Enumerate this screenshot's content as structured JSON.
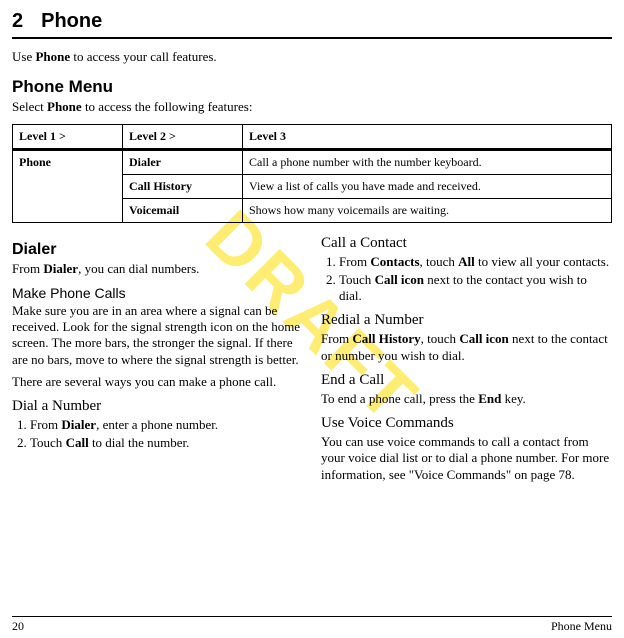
{
  "chapter": {
    "number": "2",
    "title": "Phone"
  },
  "intro": {
    "pre": "Use ",
    "bold": "Phone",
    "post": " to access your call features."
  },
  "menu": {
    "heading": "Phone Menu",
    "intro_pre": "Select ",
    "intro_bold": "Phone",
    "intro_post": " to access the following features:"
  },
  "table": {
    "headers": {
      "c1": "Level 1 >",
      "c2": "Level 2 >",
      "c3": "Level 3"
    },
    "rows": [
      {
        "c1": "Phone",
        "c2": "Dialer",
        "c3": "Call a phone number with the number keyboard."
      },
      {
        "c1": "",
        "c2": "Call History",
        "c3": "View a list of calls you have made and received."
      },
      {
        "c1": "",
        "c2": "Voicemail",
        "c3": "Shows how many voicemails are waiting."
      }
    ]
  },
  "left": {
    "dialer_h": "Dialer",
    "dialer_p_pre": "From ",
    "dialer_p_bold": "Dialer",
    "dialer_p_post": ", you can dial numbers.",
    "mpc_h": "Make Phone Calls",
    "mpc_p1": "Make sure you are in an area where a signal can be received. Look for the signal strength icon on the home screen. The more bars, the stronger the signal. If there are no bars, move to where the signal strength is better.",
    "mpc_p2": "There are several ways you can make a phone call.",
    "dan_h": "Dial a Number",
    "dan_1_pre": "From ",
    "dan_1_bold": "Dialer",
    "dan_1_post": ", enter a phone number.",
    "dan_2_pre": "Touch ",
    "dan_2_bold": "Call",
    "dan_2_post": " to dial the number."
  },
  "right": {
    "cac_h": "Call a Contact",
    "cac_1_pre": "From ",
    "cac_1_b1": "Contacts",
    "cac_1_mid": ", touch ",
    "cac_1_b2": "All",
    "cac_1_post": " to view all your contacts.",
    "cac_2_pre": "Touch ",
    "cac_2_bold": "Call icon",
    "cac_2_post": " next to the contact you wish to dial.",
    "ran_h": "Redial a Number",
    "ran_p_pre": "From ",
    "ran_p_b1": "Call History",
    "ran_p_mid": ", touch ",
    "ran_p_b2": "Call icon",
    "ran_p_post": " next to the contact or number you wish to dial.",
    "eac_h": "End a Call",
    "eac_p_pre": "To end a phone call, press the ",
    "eac_p_bold": "End",
    "eac_p_post": " key.",
    "uvc_h": "Use Voice Commands",
    "uvc_p": "You can use voice commands to call a contact from your voice dial list or to dial a phone number. For more information, see \"Voice Commands\" on page 78."
  },
  "footer": {
    "page": "20",
    "section": "Phone Menu"
  },
  "watermark": "DRAFT"
}
